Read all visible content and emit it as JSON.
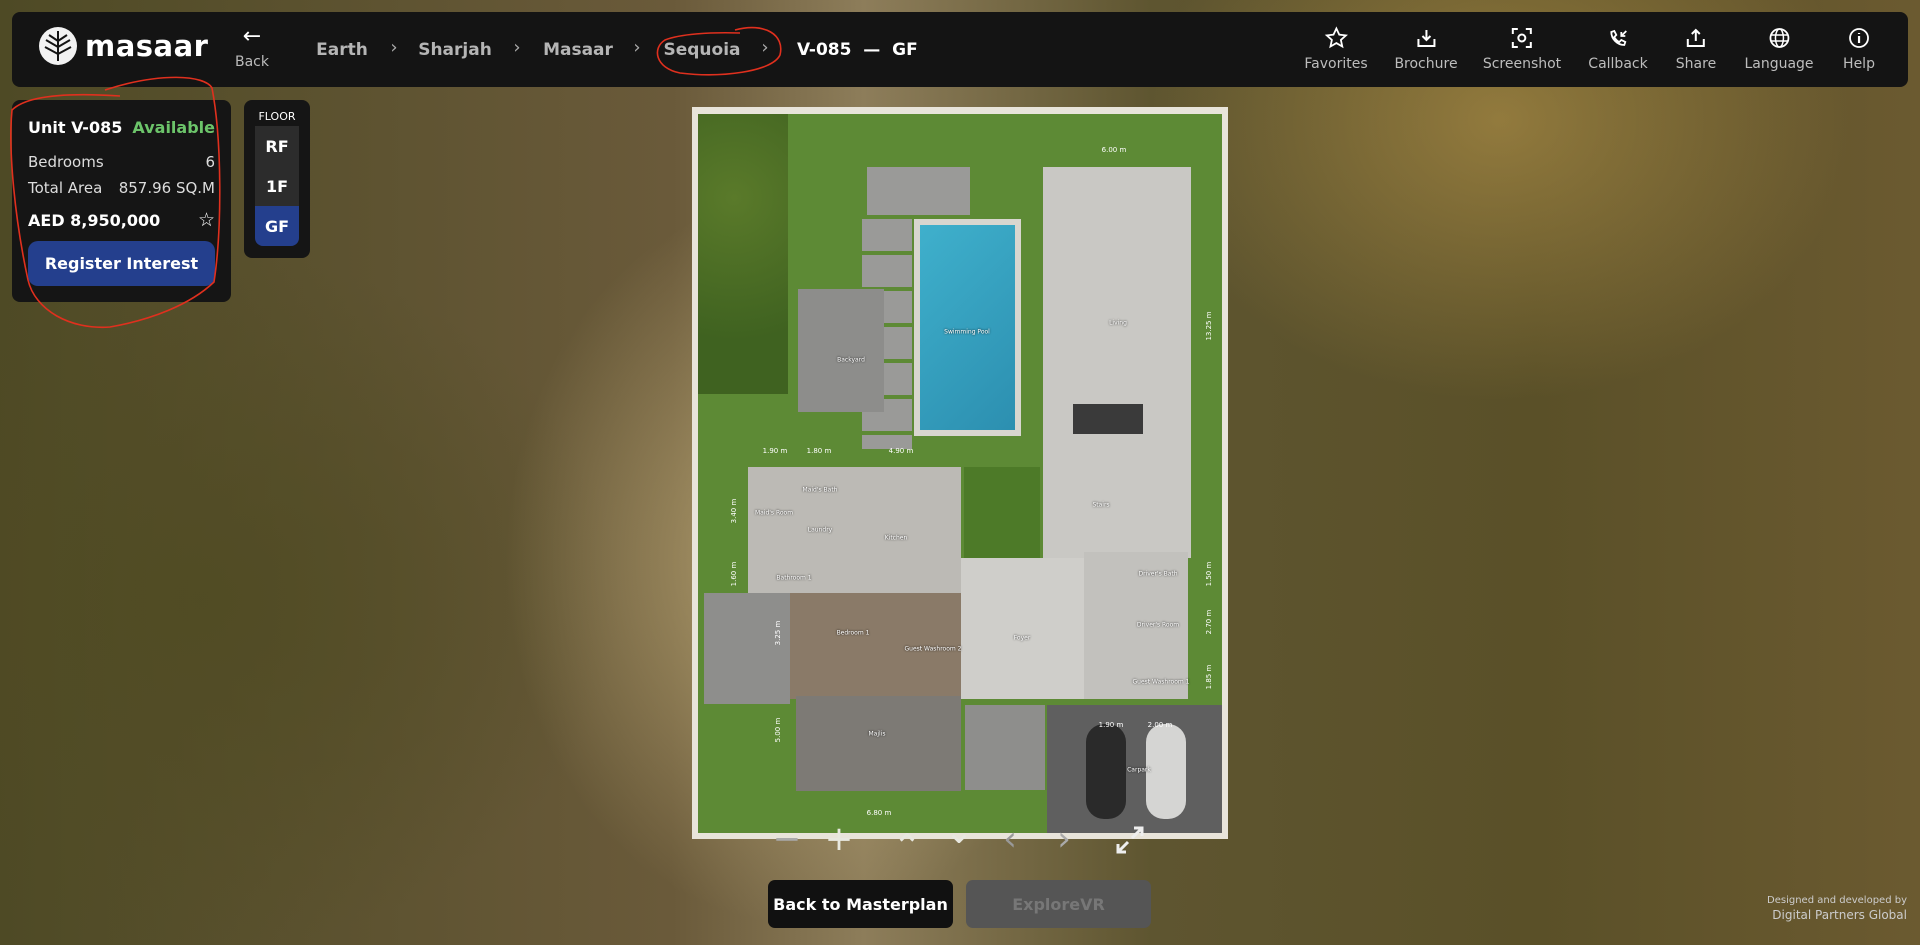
{
  "header": {
    "logo": "masaar",
    "back_label": "Back",
    "breadcrumbs": [
      "Earth",
      "Sharjah",
      "Masaar",
      "Sequoia"
    ],
    "current": "V-085  —  GF",
    "tools": [
      {
        "label": "Favorites",
        "icon": "star-icon"
      },
      {
        "label": "Brochure",
        "icon": "download-icon"
      },
      {
        "label": "Screenshot",
        "icon": "screenshot-icon"
      },
      {
        "label": "Callback",
        "icon": "phone-callback-icon"
      },
      {
        "label": "Share",
        "icon": "share-icon"
      },
      {
        "label": "Language",
        "icon": "globe-icon"
      },
      {
        "label": "Help",
        "icon": "info-icon"
      }
    ]
  },
  "unit": {
    "name": "Unit V-085",
    "status": "Available",
    "status_color": "#6cc46a",
    "bedrooms_label": "Bedrooms",
    "bedrooms": "6",
    "area_label": "Total Area",
    "area": "857.96 SQ.M",
    "price": "AED 8,950,000",
    "register_label": "Register Interest"
  },
  "floor": {
    "title": "FLOOR",
    "options": [
      "RF",
      "1F",
      "GF"
    ],
    "selected": "GF"
  },
  "plan": {
    "rooms": {
      "pool": "Swimming Pool",
      "living": "Living",
      "backyard": "Backyard",
      "kitchen": "Kitchen",
      "foyer": "Foyer",
      "majlis": "Majlis",
      "carpark": "Carpark",
      "bedroom1": "Bedroom 1",
      "maids_room": "Maid's Room",
      "maids_bath": "Maid's Bath",
      "laundry": "Laundry",
      "bathroom1": "Bathroom 1",
      "guest_wc2": "Guest Washroom 2",
      "stairs": "Stairs",
      "drivers_bath": "Driver's Bath",
      "drivers_room": "Driver's Room",
      "guest_wc1": "Guest Washroom 1"
    },
    "dims": {
      "d600": "6.00 m",
      "d1325": "13.25 m",
      "d190a": "1.90 m",
      "d180": "1.80 m",
      "d490": "4.90 m",
      "d340": "3.40 m",
      "d160": "1.60 m",
      "d325": "3.25 m",
      "d500": "5.00 m",
      "d680": "6.80 m",
      "d150": "1.50 m",
      "d270": "2.70 m",
      "d185": "1.85 m",
      "d190b": "1.90 m",
      "d200": "2.00 m"
    }
  },
  "controls": {
    "zoom_out": "−",
    "zoom_in": "+",
    "up": "⌃",
    "down": "⌄",
    "left": "‹",
    "right": "›"
  },
  "actions": {
    "masterplan": "Back to Masterplan",
    "vr": "ExploreVR"
  },
  "credit": {
    "line1": "Designed and developed by",
    "line2": "Digital Partners Global"
  },
  "colors": {
    "accent": "#243f8d",
    "annotation": "#e0301e"
  }
}
